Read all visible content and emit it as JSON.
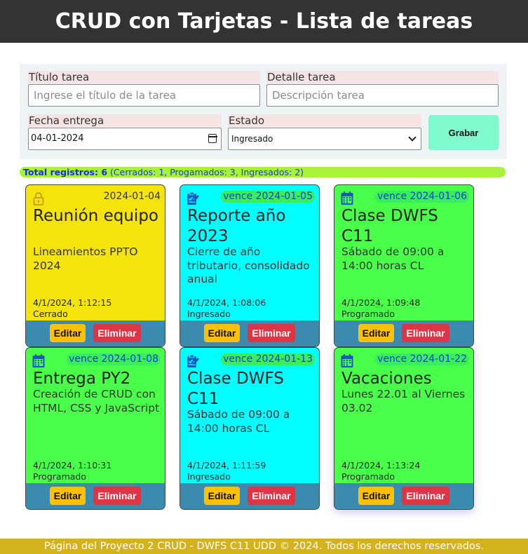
{
  "header": {
    "title": "CRUD con Tarjetas - Lista de tareas"
  },
  "form": {
    "titulo": {
      "label": "Título tarea",
      "placeholder": "Ingrese el título de la tarea"
    },
    "detalle": {
      "label": "Detalle tarea",
      "placeholder": "Descripción tarea"
    },
    "fecha": {
      "label": "Fecha entrega",
      "value": "04-01-2024"
    },
    "estado": {
      "label": "Estado",
      "value": "Ingresado"
    },
    "grabar_label": "Grabar"
  },
  "summary": {
    "total": "Total registros: 6",
    "detail": "(Cerrados: 1, Progamados: 3, Ingresados: 2)"
  },
  "colors": {
    "cerrado": "#f5e30e",
    "ingresado": "#00ffff",
    "programado": "#4aff4a",
    "actions_bar": "#3b8bae",
    "edit": "#ffc107",
    "delete": "#dc3545"
  },
  "cards": [
    {
      "icon": "lock-icon",
      "due": "2024-01-04",
      "title": "Reunión equipo",
      "detail": "Lineamientos PPTO 2024",
      "created": "4/1/2024, 1:12:15",
      "state": "Cerrado",
      "edit_label": "Editar",
      "delete_label": "Eliminar"
    },
    {
      "icon": "task-clipboard-icon",
      "due": "vence 2024-01-05",
      "title": "Reporte año 2023",
      "detail": "Cierre de año tributario, consolidado anual",
      "created": "4/1/2024, 1:08:06",
      "state": "Ingresado",
      "edit_label": "Editar",
      "delete_label": "Eliminar"
    },
    {
      "icon": "calendar-icon",
      "due": "vence 2024-01-06",
      "title": "Clase DWFS C11",
      "detail": "Sábado de 09:00 a 14:00 horas CL",
      "created": "4/1/2024, 1:09:48",
      "state": "Programado",
      "edit_label": "Editar",
      "delete_label": "Eliminar"
    },
    {
      "icon": "calendar-icon",
      "due": "vence 2024-01-08",
      "title": "Entrega PY2",
      "detail": "Creación de CRUD con HTML, CSS y JavaScript",
      "created": "4/1/2024, 1:10:31",
      "state": "Programado",
      "edit_label": "Editar",
      "delete_label": "Eliminar"
    },
    {
      "icon": "task-clipboard-icon",
      "due": "vence 2024-01-13",
      "title": "Clase DWFS C11",
      "detail": "Sábado de 09:00 a 14:00 horas CL",
      "created": "4/1/2024, 1:11:59",
      "state": "Ingresado",
      "edit_label": "Editar",
      "delete_label": "Eliminar"
    },
    {
      "icon": "calendar-icon",
      "due": "vence 2024-01-22",
      "title": "Vacaciones",
      "detail": "Lunes 22.01 al Viernes 03.02",
      "created": "4/1/2024, 1:13:24",
      "state": "Programado",
      "edit_label": "Editar",
      "delete_label": "Eliminar"
    }
  ],
  "footer": {
    "text": "Página del Proyecto 2 CRUD - DWFS C11 UDD © 2024. Todos los derechos reservados."
  }
}
